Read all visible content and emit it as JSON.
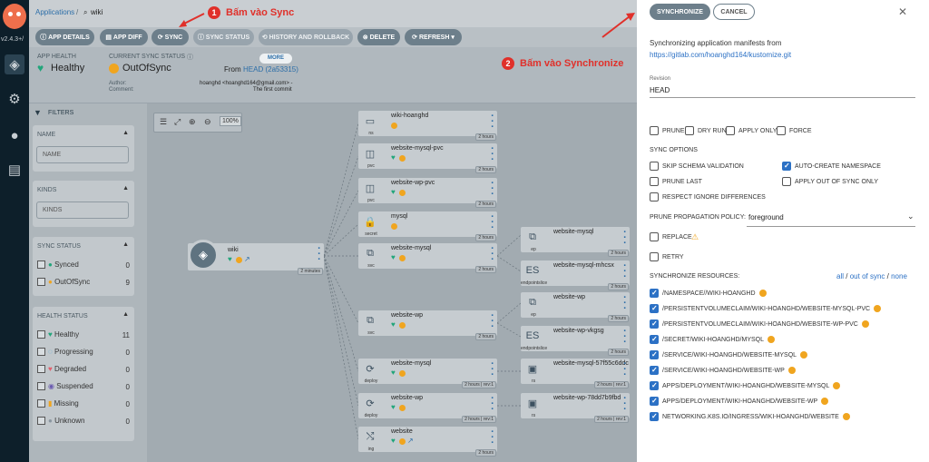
{
  "nav": {
    "version": "v2.4.3+/"
  },
  "breadcrumb": {
    "root": "Applications",
    "current": "wiki"
  },
  "annotations": {
    "step1_num": "1",
    "step1_text": "Bấm vào Sync",
    "step2_num": "2",
    "step2_text": "Bấm vào Synchronize"
  },
  "toolbar": {
    "buttons": [
      "APP DETAILS",
      "APP DIFF",
      "SYNC",
      "SYNC STATUS",
      "HISTORY AND ROLLBACK",
      "DELETE",
      "REFRESH"
    ]
  },
  "status": {
    "health_label": "APP HEALTH",
    "health_value": "Healthy",
    "sync_label": "CURRENT SYNC STATUS",
    "sync_value": "OutOfSync",
    "more": "MORE",
    "from_prefix": "From",
    "from_ref": "HEAD (2a53315)",
    "author_label": "Author:",
    "comment_label": "Comment:",
    "author_value": "hoanghd <hoanghd164@gmail.com> -",
    "comment_value": "The first commit"
  },
  "filters": {
    "title": "FILTERS",
    "name_label": "NAME",
    "name_placeholder": "NAME",
    "kinds_label": "KINDS",
    "kinds_placeholder": "KINDS",
    "sync_label": "SYNC STATUS",
    "sync_items": [
      {
        "label": "Synced",
        "count": "0"
      },
      {
        "label": "OutOfSync",
        "count": "9"
      }
    ],
    "health_label": "HEALTH STATUS",
    "health_items": [
      {
        "label": "Healthy",
        "count": "11"
      },
      {
        "label": "Progressing",
        "count": "0"
      },
      {
        "label": "Degraded",
        "count": "0"
      },
      {
        "label": "Suspended",
        "count": "0"
      },
      {
        "label": "Missing",
        "count": "0"
      },
      {
        "label": "Unknown",
        "count": "0"
      }
    ]
  },
  "graph": {
    "zoom": "100%",
    "root": {
      "name": "wiki",
      "age": "2 minutes"
    },
    "nodes": [
      {
        "name": "wiki-hoanghd",
        "kind": "ns",
        "age": "2 hours"
      },
      {
        "name": "website-mysql-pvc",
        "kind": "pvc",
        "age": "2 hours"
      },
      {
        "name": "website-wp-pvc",
        "kind": "pvc",
        "age": "2 hours"
      },
      {
        "name": "mysql",
        "kind": "secret",
        "age": "2 hours"
      },
      {
        "name": "website-mysql",
        "kind": "svc",
        "age": "2 hours"
      },
      {
        "name": "website-wp",
        "kind": "svc",
        "age": "2 hours"
      },
      {
        "name": "website-mysql",
        "kind": "deploy",
        "age": "2 hours",
        "rev": "rev:1"
      },
      {
        "name": "website-wp",
        "kind": "deploy",
        "age": "2 hours",
        "rev": "rev:1"
      },
      {
        "name": "website",
        "kind": "ing",
        "age": "2 hours"
      }
    ],
    "children": [
      {
        "name": "website-mysql",
        "kind": "ep",
        "age": "2 hours"
      },
      {
        "name": "website-mysql-mhcsx",
        "kind": "endpointslice",
        "age": "2 hours"
      },
      {
        "name": "website-wp",
        "kind": "ep",
        "age": "2 hours"
      },
      {
        "name": "website-wp-vkgsg",
        "kind": "endpointslice",
        "age": "2 hours"
      },
      {
        "name": "website-mysql-57f55c6ddc",
        "kind": "rs",
        "age": "2 hours",
        "rev": "rev:1"
      },
      {
        "name": "website-wp-78dd7b9fbd",
        "kind": "rs",
        "age": "2 hours",
        "rev": "rev:1"
      }
    ]
  },
  "panel": {
    "synchronize": "SYNCHRONIZE",
    "cancel": "CANCEL",
    "close": "✕",
    "sync_from": "Synchronizing application manifests from",
    "repo_url": "https://gitlab.com/hoanghd164/kustomize.git",
    "revision_label": "Revision",
    "revision_value": "HEAD",
    "options_top": [
      {
        "label": "PRUNE",
        "checked": false
      },
      {
        "label": "DRY RUN",
        "checked": false
      },
      {
        "label": "APPLY ONLY",
        "checked": false
      },
      {
        "label": "FORCE",
        "checked": false
      }
    ],
    "sync_options_label": "SYNC OPTIONS",
    "sync_options": [
      {
        "label": "SKIP SCHEMA VALIDATION",
        "checked": false
      },
      {
        "label": "AUTO-CREATE NAMESPACE",
        "checked": true
      },
      {
        "label": "PRUNE LAST",
        "checked": false
      },
      {
        "label": "APPLY OUT OF SYNC ONLY",
        "checked": false
      },
      {
        "label": "RESPECT IGNORE DIFFERENCES",
        "checked": false
      }
    ],
    "prune_policy_label": "PRUNE PROPAGATION POLICY:",
    "prune_policy_value": "foreground",
    "replace_label": "REPLACE",
    "retry_label": "RETRY",
    "resources_label": "SYNCHRONIZE RESOURCES:",
    "sel_all": "all",
    "sel_sep1": "/",
    "sel_out": "out of sync",
    "sel_sep2": "/",
    "sel_none": "none",
    "resources": [
      "/NAMESPACE//WIKI-HOANGHD",
      "/PERSISTENTVOLUMECLAIM/WIKI-HOANGHD/WEBSITE-MYSQL-PVC",
      "/PERSISTENTVOLUMECLAIM/WIKI-HOANGHD/WEBSITE-WP-PVC",
      "/SECRET/WIKI-HOANGHD/MYSQL",
      "/SERVICE/WIKI-HOANGHD/WEBSITE-MYSQL",
      "/SERVICE/WIKI-HOANGHD/WEBSITE-WP",
      "APPS/DEPLOYMENT/WIKI-HOANGHD/WEBSITE-MYSQL",
      "APPS/DEPLOYMENT/WIKI-HOANGHD/WEBSITE-WP",
      "NETWORKING.K8S.IO/INGRESS/WIKI-HOANGHD/WEBSITE"
    ]
  }
}
